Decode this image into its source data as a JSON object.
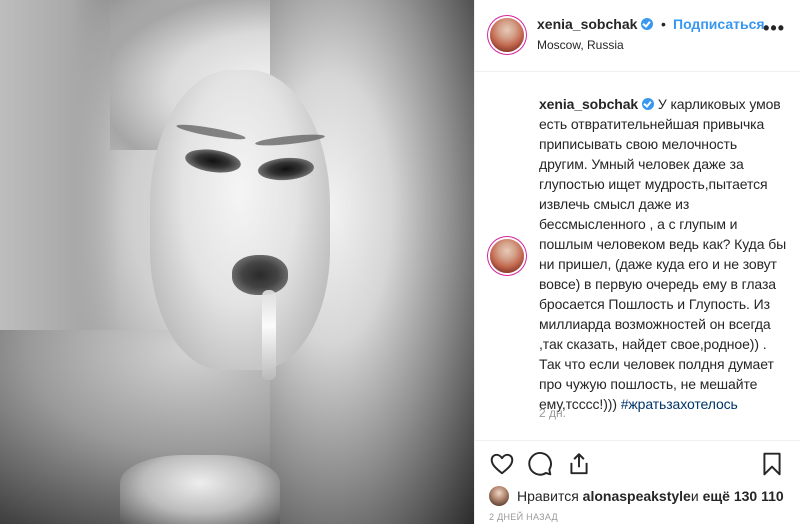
{
  "post": {
    "username": "xenia_sobchak",
    "follow_label": "Подписаться",
    "dot": "•",
    "location": "Moscow, Russia",
    "more_icon": "more-horizontal-icon",
    "more_label": "•••"
  },
  "caption": {
    "username": "xenia_sobchak",
    "text": "У карликовых умов есть отвратительнейшая привычка приписывать свою мелочность другим. Умный человек даже за глупостью ищет мудрость,пытается извлечь смысл даже из бессмысленного , а с глупым и пошлым человеком ведь как? Куда бы ни пришел, (даже куда его и не зовут вовсе) в первую очередь ему в глаза бросается Пошлость и Глупость. Из миллиарда возможностей он всегда ,так сказать, найдет свое,родное)) . Так что если человек полдня думает про чужую пошлость, не мешайте ему,тсссс!))) ",
    "hashtag": "#жратьзахотелось",
    "time_ago": "2 дн."
  },
  "likes": {
    "prefix": "Нравится ",
    "user": "alonaspeakstyle",
    "middle": " и ",
    "count": "ещё 130 110"
  },
  "date": "2 ДНЕЙ НАЗАД",
  "colors": {
    "accent": "#3897f0",
    "hashtag": "#003569",
    "muted": "#999999",
    "border": "#efefef"
  },
  "icons": [
    "heart-icon",
    "comment-icon",
    "share-icon",
    "bookmark-icon"
  ]
}
